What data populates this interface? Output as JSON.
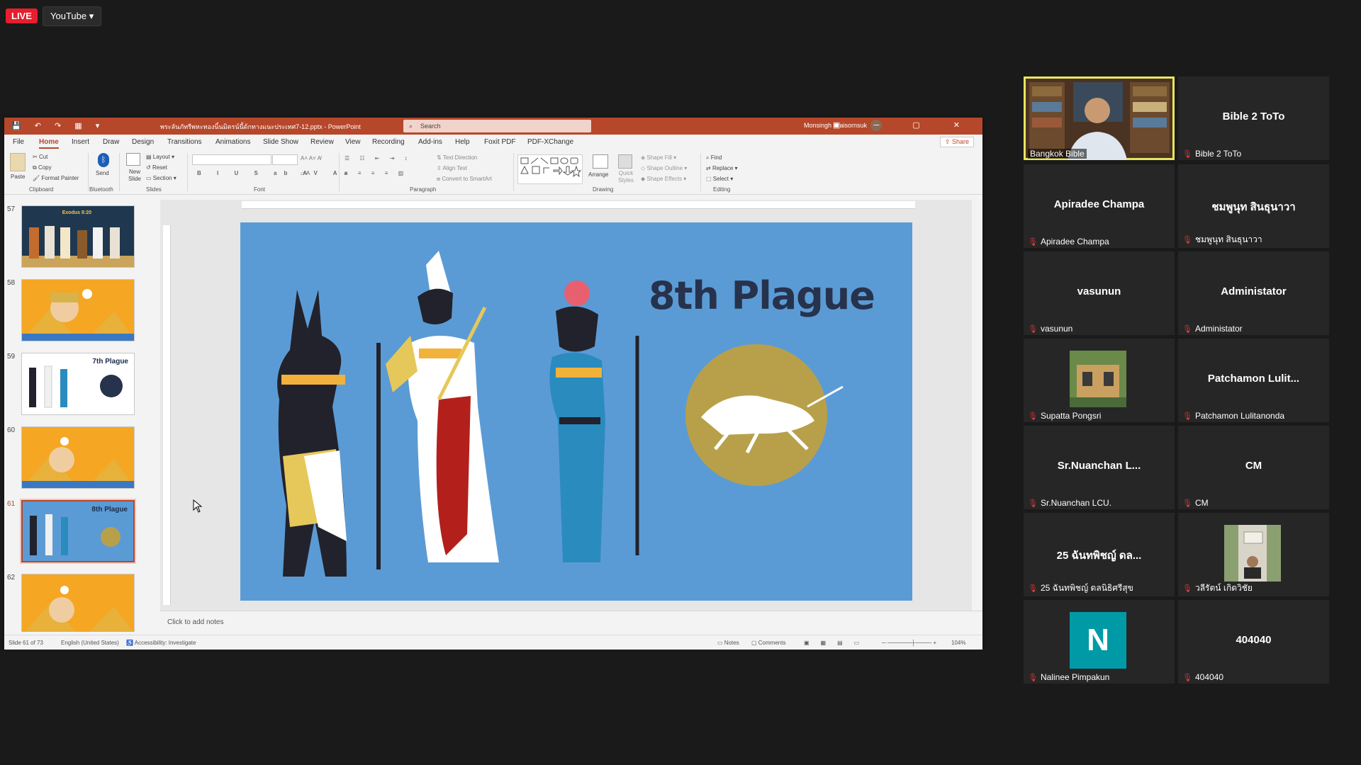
{
  "stream": {
    "live_label": "LIVE",
    "platform": "YouTube ▾"
  },
  "ppt": {
    "quick_access": "💾 ↶ ↷ ▦ ▾",
    "file_title": "พระลันภัทรีพหะทองนิ์นมิตรน์นี้ด้กทางแนะประเทศ7-12.pptx - PowerPoint",
    "search_placeholder": "Search",
    "user": "Monsingh Kraisornsuk",
    "window_buttons": "▣ ─ ▢ ✕",
    "menu": [
      "File",
      "Home",
      "Insert",
      "Draw",
      "Design",
      "Transitions",
      "Animations",
      "Slide Show",
      "Review",
      "View",
      "Recording",
      "Add-ins",
      "Help",
      "Foxit PDF",
      "PDF-XChange"
    ],
    "share": "Share",
    "ribbon": {
      "paste": "Paste",
      "cut": "Cut",
      "copy": "Copy",
      "format_painter": "Format Painter",
      "send": "Send",
      "new_slide": "New Slide",
      "layout": "Layout",
      "reset": "Reset",
      "section": "Section",
      "text_direction": "Text Direction",
      "align_text": "Align Text",
      "convert_smartart": "Convert to SmartArt",
      "arrange": "Arrange",
      "quick_styles": "Quick Styles",
      "shape_fill": "Shape Fill",
      "shape_outline": "Shape Outline",
      "shape_effects": "Shape Effects",
      "find": "Find",
      "replace": "Replace",
      "select": "Select",
      "groups": {
        "clipboard": "Clipboard",
        "bluetooth": "Bluetooth",
        "slides": "Slides",
        "font": "Font",
        "paragraph": "Paragraph",
        "drawing": "Drawing",
        "editing": "Editing"
      }
    },
    "thumbnails": [
      {
        "num": "57",
        "title": "Exodus 8:20",
        "bg": "#1f3850"
      },
      {
        "num": "58",
        "title": "",
        "bg": "#f5a623"
      },
      {
        "num": "59",
        "title": "7th Plague",
        "bg": "#ffffff"
      },
      {
        "num": "60",
        "title": "",
        "bg": "#f5a623"
      },
      {
        "num": "61",
        "title": "8th Plague",
        "bg": "#5b9bd5"
      },
      {
        "num": "62",
        "title": "",
        "bg": "#f5a623"
      }
    ],
    "slide_title": "8th Plague",
    "notes_placeholder": "Click to add notes",
    "status": {
      "slide": "Slide 61 of 73",
      "language": "English (United States)",
      "accessibility": "Accessibility: Investigate",
      "notes": "Notes",
      "comments": "Comments",
      "zoom": "104%"
    }
  },
  "participants": [
    {
      "center": "",
      "label": "Bangkok Bible",
      "active": true,
      "type": "video"
    },
    {
      "center": "Bible 2 ToTo",
      "label": "Bible 2 ToTo"
    },
    {
      "center": "Apiradee Champa",
      "label": "Apiradee Champa"
    },
    {
      "center": "ชมพูนุท สินธุนาวา",
      "label": "ชมพูนุท สินธุนาวา"
    },
    {
      "center": "vasunun",
      "label": "vasunun"
    },
    {
      "center": "Administator",
      "label": "Administator"
    },
    {
      "center": "",
      "label": "Supatta Pongsri",
      "type": "photo"
    },
    {
      "center": "Patchamon  Lulit...",
      "label": "Patchamon Lulitanonda"
    },
    {
      "center": "Sr.Nuanchan    L...",
      "label": "Sr.Nuanchan   LCU."
    },
    {
      "center": "CM",
      "label": "CM"
    },
    {
      "center": "25 ฉันทพิชญ์ ดล...",
      "label": "25 ฉันทพิชญ์ ดลนิธิศรีสุข"
    },
    {
      "center": "",
      "label": "วลีรัตน์ เกิดวิชัย",
      "type": "photo"
    },
    {
      "center": "N",
      "label": "Nalinee Pimpakun",
      "type": "initial"
    },
    {
      "center": "404040",
      "label": "404040"
    }
  ],
  "colors": {
    "ppt_accent": "#b7472a",
    "slide_bg": "#5b9bd5",
    "tile_bg": "#262626",
    "active_border": "#e8e55e",
    "mic_muted": "#e5393b"
  }
}
